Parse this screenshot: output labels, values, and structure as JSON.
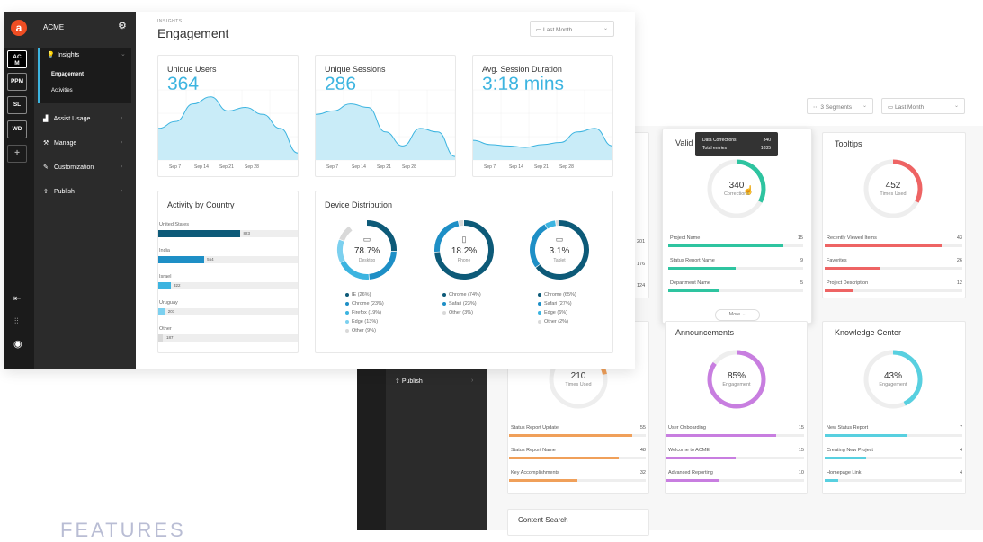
{
  "app": {
    "name": "ACME"
  },
  "rail": {
    "items": [
      "AC\nM",
      "PPM",
      "SL",
      "WD",
      "+"
    ]
  },
  "menu": {
    "items": [
      {
        "label": "Insights",
        "icon": "lightbulb-icon"
      },
      {
        "label": "Assist Usage",
        "icon": "bar-chart-icon"
      },
      {
        "label": "Manage",
        "icon": "manage-icon"
      },
      {
        "label": "Customization",
        "icon": "brush-icon"
      },
      {
        "label": "Publish",
        "icon": "publish-icon"
      }
    ],
    "sub_items": [
      "Engagement",
      "Activities"
    ]
  },
  "header": {
    "eyebrow": "INSIGHTS",
    "title": "Engagement",
    "period": "Last Month"
  },
  "metrics": [
    {
      "title": "Unique Users",
      "value": "364",
      "x_labels": [
        "Sep 7",
        "Sep 14",
        "Sep 21",
        "Sep 28"
      ]
    },
    {
      "title": "Unique Sessions",
      "value": "286",
      "x_labels": [
        "Sep 7",
        "Sep 14",
        "Sep 21",
        "Sep 28"
      ]
    },
    {
      "title": "Avg. Session Duration",
      "value": "3:18 mins",
      "x_labels": [
        "Sep 7",
        "Sep 14",
        "Sep 21",
        "Sep 28"
      ]
    }
  ],
  "country": {
    "title": "Activity by Country",
    "rows": [
      {
        "name": "United States",
        "value": "823",
        "frac": 0.59,
        "color": "#0d5a78"
      },
      {
        "name": "India",
        "value": "554",
        "frac": 0.33,
        "color": "#1e8fc6"
      },
      {
        "name": "Israel",
        "value": "322",
        "frac": 0.09,
        "color": "#3cb4e0"
      },
      {
        "name": "Uruguay",
        "value": "201",
        "frac": 0.05,
        "color": "#7cd0ef"
      },
      {
        "name": "Other",
        "value": "187",
        "frac": 0.03,
        "color": "#d9d9d9"
      }
    ]
  },
  "devices": {
    "title": "Device Distribution",
    "items": [
      {
        "pct": "78.7%",
        "name": "Desktop",
        "icon": "monitor-icon",
        "legend": [
          "IE (26%)",
          "Chrome (23%)",
          "Firefox (19%)",
          "Edge (13%)",
          "Other (9%)"
        ],
        "colors": [
          "#0d5a78",
          "#1e8fc6",
          "#3cb4e0",
          "#7cd0ef",
          "#d9d9d9"
        ]
      },
      {
        "pct": "18.2%",
        "name": "Phone",
        "icon": "phone-icon",
        "legend": [
          "Chrome (74%)",
          "Safari (23%)",
          "Other (3%)"
        ],
        "colors": [
          "#0d5a78",
          "#1e8fc6",
          "#d9d9d9"
        ]
      },
      {
        "pct": "3.1%",
        "name": "Tablet",
        "icon": "tablet-icon",
        "legend": [
          "Chrome (65%)",
          "Safari (27%)",
          "Edge (6%)",
          "Other (2%)"
        ],
        "colors": [
          "#0d5a78",
          "#1e8fc6",
          "#3cb4e0",
          "#d9d9d9"
        ]
      }
    ]
  },
  "back": {
    "segments": "3 Segments",
    "period": "Last Month",
    "publish": "Publish",
    "left_values": [
      "201",
      "176",
      "124"
    ],
    "tooltip": {
      "line1_label": "Data Corrections",
      "line1_value": "340",
      "line2_label": "Total entries",
      "line2_value": "1035"
    },
    "cards": [
      {
        "title": "Valid",
        "value": "340",
        "sub": "Corrections",
        "color": "#2ec4a0",
        "frac": 0.33,
        "rows": [
          {
            "label": "Project Name",
            "value": "15",
            "frac": 0.85
          },
          {
            "label": "Status Report Name",
            "value": "9",
            "frac": 0.5
          },
          {
            "label": "Department Name",
            "value": "5",
            "frac": 0.38
          }
        ],
        "more": "More"
      },
      {
        "title": "Tooltips",
        "value": "452",
        "sub": "Times Used",
        "color": "#ee6464",
        "frac": 0.33,
        "rows": [
          {
            "label": "Recently Viewed Items",
            "value": "43",
            "frac": 0.85
          },
          {
            "label": "Favorites",
            "value": "26",
            "frac": 0.4
          },
          {
            "label": "Project Description",
            "value": "12",
            "frac": 0.2
          }
        ]
      },
      {
        "title": "",
        "value": "210",
        "sub": "Times Used",
        "color": "#f0a05a",
        "frac": 0.1,
        "rows": [
          {
            "label": "Status Report Update",
            "value": "55",
            "frac": 0.9
          },
          {
            "label": "Status Report Name",
            "value": "48",
            "frac": 0.8
          },
          {
            "label": "Key Accomplishments",
            "value": "32",
            "frac": 0.5
          }
        ]
      },
      {
        "title": "Announcements",
        "value": "85%",
        "sub": "Engagement",
        "color": "#c87ee0",
        "frac": 0.85,
        "rows": [
          {
            "label": "User Onboarding",
            "value": "15",
            "frac": 0.8
          },
          {
            "label": "Welcome to ACME",
            "value": "15",
            "frac": 0.5
          },
          {
            "label": "Advanced Reporting",
            "value": "10",
            "frac": 0.38
          }
        ]
      },
      {
        "title": "Knowledge Center",
        "value": "43%",
        "sub": "Engagement",
        "color": "#58d0e0",
        "frac": 0.43,
        "rows": [
          {
            "label": "New Status Report",
            "value": "7",
            "frac": 0.6
          },
          {
            "label": "Creating New Project",
            "value": "4",
            "frac": 0.3
          },
          {
            "label": "Homepage Link",
            "value": "4",
            "frac": 0.1
          }
        ]
      }
    ],
    "content_search": "Content Search"
  },
  "features_heading": "FEATURES"
}
